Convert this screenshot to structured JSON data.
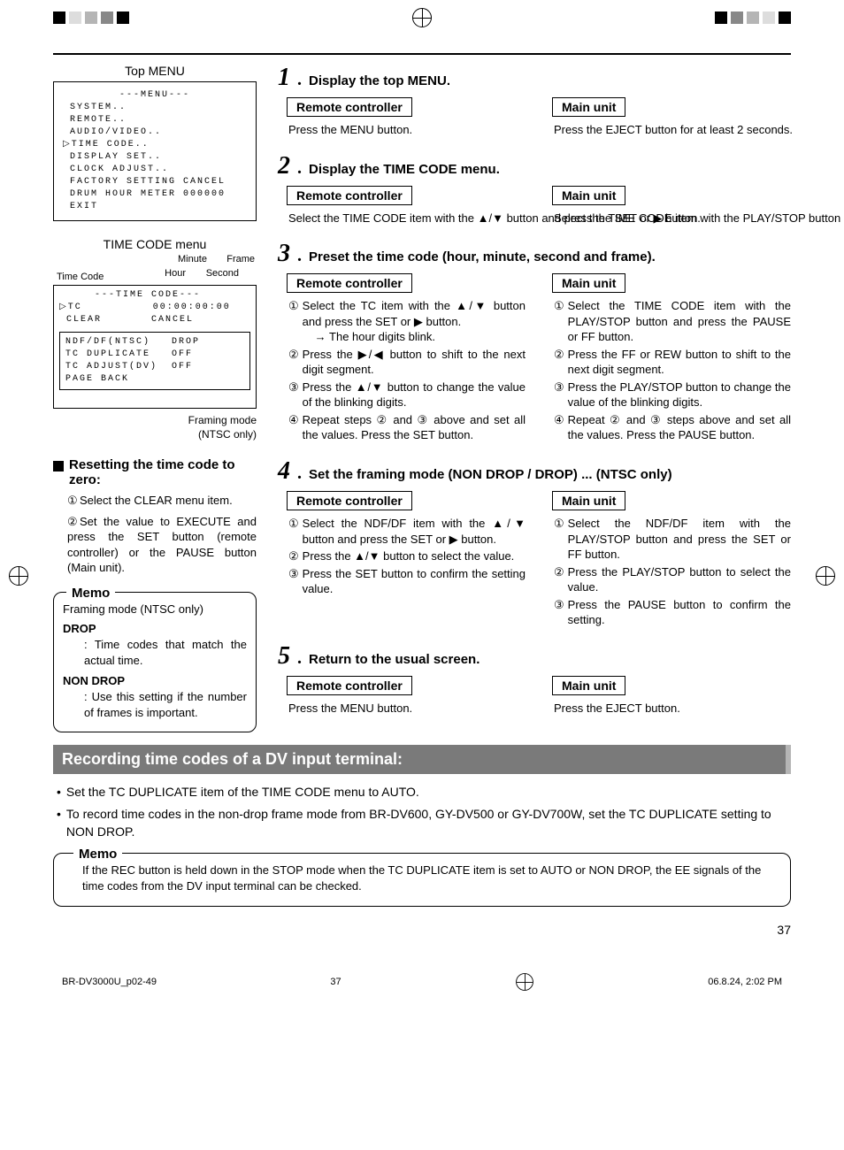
{
  "topMenu": {
    "title": "Top MENU",
    "header": "---MENU---",
    "lines": [
      "SYSTEM..",
      "REMOTE..",
      "AUDIO/VIDEO..",
      "TIME CODE..",
      "DISPLAY SET..",
      "CLOCK ADJUST..",
      "FACTORY SETTING CANCEL",
      "DRUM HOUR METER 000000",
      "EXIT"
    ],
    "cursorIndex": 3
  },
  "tcMenu": {
    "title": "TIME CODE menu",
    "label_timecode": "Time Code",
    "label_minute": "Minute",
    "label_hour": "Hour",
    "label_second": "Second",
    "label_frame": "Frame",
    "box_header": "---TIME CODE---",
    "tc_line": "TC          00:00:00:00",
    "clear_line": " CLEAR       CANCEL",
    "sub_lines": [
      "NDF/DF(NTSC)   DROP",
      "TC DUPLICATE   OFF",
      "TC ADJUST(DV)  OFF",
      "PAGE BACK"
    ],
    "caption1": "Framing mode",
    "caption2": "(NTSC only)"
  },
  "reset": {
    "heading": "Resetting the time code to zero:",
    "items": [
      "Select the CLEAR menu item.",
      "Set the value to EXECUTE and press the SET button (remote controller) or the PAUSE button (Main unit)."
    ]
  },
  "memoLeft": {
    "label": "Memo",
    "line1": "Framing mode (NTSC only)",
    "drop_term": "DROP",
    "drop_def": ": Time codes that match the actual time.",
    "nondrop_term": "NON DROP",
    "nondrop_def": ": Use this setting if the number of frames is important."
  },
  "labels": {
    "remote": "Remote controller",
    "main": "Main unit"
  },
  "steps": [
    {
      "num": "1",
      "title": "Display the top MENU.",
      "remote": [
        {
          "t": "Press the MENU button."
        }
      ],
      "main": [
        {
          "t": "Press the EJECT button for at least 2 seconds."
        }
      ]
    },
    {
      "num": "2",
      "title": "Display the TIME CODE menu.",
      "remote": [
        {
          "t": "Select the TIME CODE item with the ▲/▼ button and press the SET or ▶ button."
        }
      ],
      "main": [
        {
          "t": "Select the TIME CODE item with the PLAY/STOP button and press the PAUSE or FF button."
        }
      ]
    },
    {
      "num": "3",
      "title": "Preset the time code (hour, minute, second and frame).",
      "remote": [
        {
          "n": "①",
          "t": "Select the TC item with the ▲/▼ button and press the SET or ▶ button.",
          "sub": "→ The hour digits blink."
        },
        {
          "n": "②",
          "t": "Press the ▶/◀ button to shift to the next digit segment."
        },
        {
          "n": "③",
          "t": "Press the ▲/▼ button to change the value of the blinking digits."
        },
        {
          "n": "④",
          "t": "Repeat steps ② and ③ above and set all the values. Press the SET button."
        }
      ],
      "main": [
        {
          "n": "①",
          "t": "Select the TIME CODE item with the PLAY/STOP button and press the PAUSE or FF button."
        },
        {
          "n": "②",
          "t": "Press the FF or REW button to shift to the next digit segment."
        },
        {
          "n": "③",
          "t": "Press the PLAY/STOP button to change the value of the blinking digits."
        },
        {
          "n": "④",
          "t": "Repeat ② and ③ steps above and set all the values. Press the PAUSE button."
        }
      ]
    },
    {
      "num": "4",
      "title": "Set the framing mode (NON DROP / DROP) ... (NTSC only)",
      "remote": [
        {
          "n": "①",
          "t": "Select the NDF/DF item with the ▲/▼ button and press the SET or ▶ button."
        },
        {
          "n": "②",
          "t": "Press the ▲/▼ button to select the value."
        },
        {
          "n": "③",
          "t": "Press the SET button to confirm the setting value."
        }
      ],
      "main": [
        {
          "n": "①",
          "t": "Select the NDF/DF item with the PLAY/STOP button and press the SET or FF button."
        },
        {
          "n": "②",
          "t": "Press the PLAY/STOP button to select the value."
        },
        {
          "n": "③",
          "t": "Press the PAUSE button to confirm the setting."
        }
      ]
    },
    {
      "num": "5",
      "title": "Return to the usual screen.",
      "remote": [
        {
          "t": "Press the MENU button."
        }
      ],
      "main": [
        {
          "t": "Press the EJECT button."
        }
      ]
    }
  ],
  "section": {
    "title": "Recording time codes of a DV input terminal:",
    "bullets": [
      "Set the TC DUPLICATE item of the TIME CODE menu to AUTO.",
      "To record time codes in the non-drop frame mode from BR-DV600, GY-DV500 or GY-DV700W, set the TC DUPLICATE setting to NON DROP."
    ]
  },
  "memoWide": {
    "label": "Memo",
    "text": "If the REC button is held down in the STOP mode when the TC DUPLICATE item is set to AUTO or NON DROP, the EE signals of the time codes from the DV input terminal can be checked."
  },
  "pageNum": "37",
  "footer": {
    "left": "BR-DV3000U_p02-49",
    "mid": "37",
    "right": "06.8.24, 2:02 PM"
  }
}
